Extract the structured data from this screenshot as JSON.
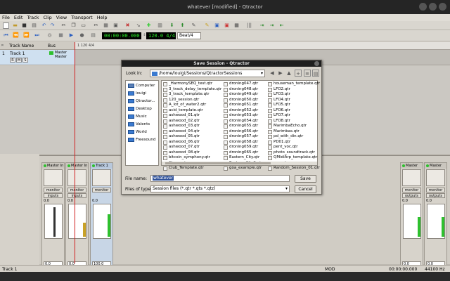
{
  "window": {
    "title": "whatever [modified] - Qtractor"
  },
  "menu": [
    "File",
    "Edit",
    "Track",
    "Clip",
    "View",
    "Transport",
    "Help"
  ],
  "transport": {
    "time": "00:00:00.000",
    "tempo": "120.0 4/4",
    "snap": "Beat/4"
  },
  "tracks_header": {
    "name_col": "Track Name",
    "bus_col": "Bus"
  },
  "track": {
    "number": "1",
    "name": "Track 1",
    "bus_in": "Master",
    "bus_out": "Master",
    "buttons": [
      "R",
      "M",
      "S"
    ]
  },
  "timeline": {
    "marker": "1  120 4/4"
  },
  "dialog": {
    "title": "Save Session - Qtractor",
    "look_in_label": "Look in:",
    "look_in_path": "/home/louigi/Sessions/QtractorSessions",
    "places": [
      "Computer",
      "louigi",
      "Qtractor...",
      "Desktop",
      "Music",
      "Valents",
      "World",
      "Freesound"
    ],
    "files_col1": [
      "_HarmonySEQ_test.qtr",
      "3_track_delay_template.qtr",
      "3_track_template.qtr",
      "120_session.qtr",
      "A_lot_of_water2.qtr",
      "acid_template.qtr",
      "ashwood_01.qtr",
      "ashwood_02.qtr",
      "ashwood_03.qtr",
      "ashwood_04.qtr",
      "ashwood_05.qtr",
      "ashwood_06.qtr",
      "ashwood_07.qtr",
      "ashwood_08.qtr",
      "bitcoin_symphony.qtr",
      "Circus.qtr",
      "Club_Template.qtr"
    ],
    "files_col2": [
      "droning047.qtr",
      "droning048.qtr",
      "droning049.qtr",
      "droning050.qtr",
      "droning051.qtr",
      "droning052.qtr",
      "droning053.qtr",
      "droning054.qtr",
      "droning055.qtr",
      "droning056.qtr",
      "droning057.qtr",
      "droning058.qtr",
      "droning059.qtr",
      "droning065.qtr",
      "Eastern_City.qtr",
      "Eastern_City2.qtr",
      "goa_example.qtr"
    ],
    "files_col3": [
      "houseman_template.qtr",
      "LFO2.qtr",
      "LFO3.qtr",
      "LFO4.qtr",
      "LFO5.qtr",
      "LFO6.qtr",
      "LFO7.qtr",
      "LFO8.qtr",
      "MarimbaEcho.qtr",
      "Marimbas.qtr",
      "pd_with_din.qtr",
      "PD01.qtr",
      "pent_voc.qtr",
      "photo_soundtrack.qtr",
      "QMidiArp_template.qtr",
      "qws.qtr",
      "Random_Session_01.qtr"
    ],
    "file_name_label": "File name:",
    "file_name_value": "whatever",
    "file_type_label": "Files of type:",
    "file_type_value": "Session files (*.qtr *.qts *.qtz)",
    "save_label": "Save",
    "cancel_label": "Cancel"
  },
  "mixer": {
    "strips": [
      {
        "name": "Master In",
        "monitor": "monitor",
        "io": "inputs",
        "gain": "0.0",
        "value": "0.0"
      },
      {
        "name": "Master In",
        "monitor": "monitor",
        "io": "inputs",
        "gain": "0.0",
        "value": "0.0"
      },
      {
        "name": "Track 1",
        "monitor": "monitor",
        "io": "",
        "gain": "0.0",
        "value": "100.0"
      },
      {
        "name": "Master Out",
        "monitor": "monitor",
        "io": "outputs",
        "gain": "0.0",
        "value": "0.0"
      },
      {
        "name": "Master Out",
        "monitor": "monitor",
        "io": "outputs",
        "gain": "0.0",
        "value": "0.0"
      }
    ]
  },
  "status": {
    "left": "Track 1",
    "mode": "MOD",
    "time": "00:00:00.000",
    "rate": "44100 Hz"
  },
  "colors": {
    "accent": "#31539b",
    "lcd_text": "#26e626",
    "playhead": "#d02020"
  }
}
